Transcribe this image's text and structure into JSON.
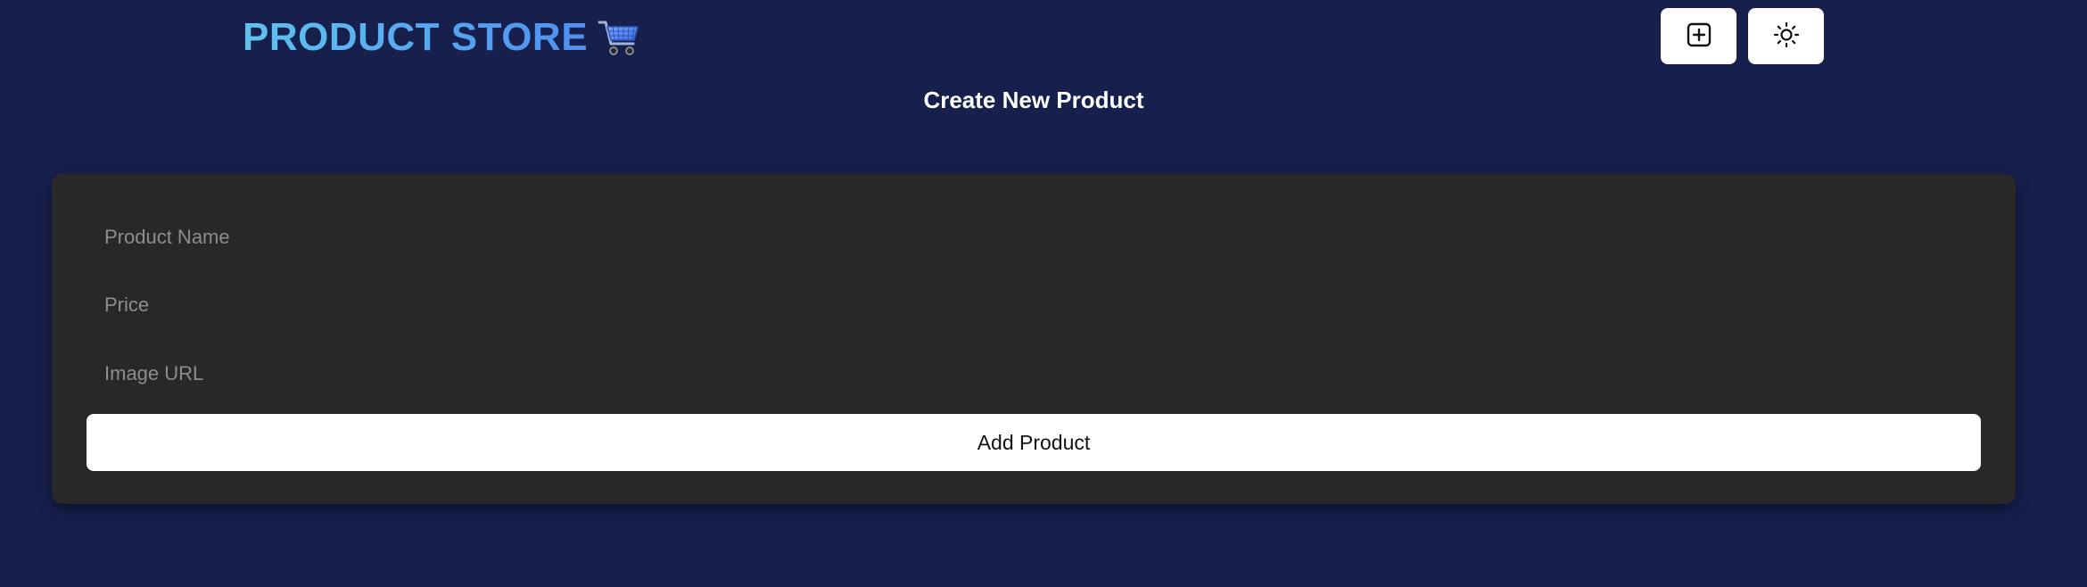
{
  "navbar": {
    "brand_text": "PRODUCT STORE",
    "brand_icon": "shopping-cart-icon",
    "create_button_icon": "plus-square-icon",
    "theme_button_icon": "sun-icon"
  },
  "page": {
    "heading": "Create New Product"
  },
  "form": {
    "name_placeholder": "Product Name",
    "name_value": "",
    "price_placeholder": "Price",
    "price_value": "",
    "image_placeholder": "Image URL",
    "image_value": "",
    "submit_label": "Add Product"
  },
  "colors": {
    "background": "#171f4d",
    "card": "#282829",
    "brand_gradient_start": "#5fc3ee",
    "brand_gradient_end": "#4f8ff0",
    "button_bg": "#ffffff"
  }
}
